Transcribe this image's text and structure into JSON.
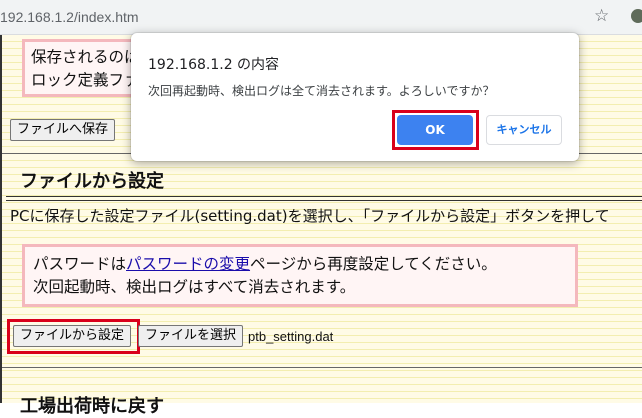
{
  "browser": {
    "url": "192.168.1.2/index.htm"
  },
  "top_section": {
    "notice_line1": "保存されるのは",
    "notice_line2": "ロック定義ファ",
    "save_button": "ファイルへ保存"
  },
  "file_settings": {
    "title": "ファイルから設定",
    "description": "PCに保存した設定ファイル(setting.dat)を選択し、「ファイルから設定」ボタンを押して",
    "notice_prefix": "パスワードは",
    "notice_link": "パスワードの変更",
    "notice_suffix": "ページから再度設定してください。",
    "notice_line2": "次回起動時、検出ログはすべて消去されます。",
    "apply_button": "ファイルから設定",
    "choose_button": "ファイルを選択",
    "selected_file": "ptb_setting.dat"
  },
  "next_section": {
    "title": "工場出荷時に戻す"
  },
  "dialog": {
    "title": "192.168.1.2 の内容",
    "message": "次回再起動時、検出ログは全て消去されます。よろしいですか？",
    "ok_label": "OK",
    "cancel_label": "キャンセル"
  },
  "colors": {
    "ok_button": "#3d82f0",
    "highlight_outline": "#d9001b",
    "notice_border": "#f4b8bd"
  }
}
